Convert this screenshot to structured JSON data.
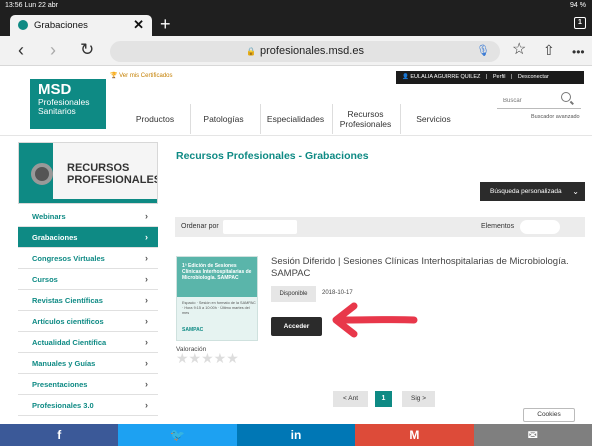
{
  "status_bar": {
    "time": "13:56 Lun 22 abr",
    "system": "94 %"
  },
  "browser": {
    "tab_title": "Grabaciones",
    "tab_close": "✕",
    "new_tab": "+",
    "tab_count": "1",
    "url": "profesionales.msd.es",
    "back_icon": "‹",
    "forward_icon": "›",
    "reload_icon": "↻",
    "star_icon": "☆",
    "share_icon": "⇧",
    "more_icon": "•••"
  },
  "header": {
    "logo_brand": "MSD",
    "logo_line1": "Profesionales",
    "logo_line2": "Sanitarios",
    "certificates_link": "Ver mis Certificados",
    "user_name": "EULALIA AGUIRRE QUILEZ",
    "profile_link": "Perfil",
    "logout_link": "Desconectar",
    "search_placeholder": "Buscar",
    "advanced_search": "Buscador avanzado",
    "nav": [
      {
        "label": "Productos"
      },
      {
        "label": "Patologías"
      },
      {
        "label": "Especialidades"
      },
      {
        "label": "Recursos Profesionales"
      },
      {
        "label": "Servicios"
      }
    ]
  },
  "sidebar": {
    "banner_title_1": "RECURSOS",
    "banner_title_2": "PROFESIONALES",
    "items": [
      {
        "label": "Webinars"
      },
      {
        "label": "Grabaciones"
      },
      {
        "label": "Congresos Virtuales"
      },
      {
        "label": "Cursos"
      },
      {
        "label": "Revistas Científicas"
      },
      {
        "label": "Artículos científicos"
      },
      {
        "label": "Actualidad Científica"
      },
      {
        "label": "Manuales y Guías"
      },
      {
        "label": "Presentaciones"
      },
      {
        "label": "Profesionales 3.0"
      }
    ],
    "chevron": "›"
  },
  "main": {
    "title": "Recursos Profesionales - Grabaciones",
    "custom_search": "Búsqueda personalizada",
    "custom_search_chevron": "⌄",
    "order_label": "Ordenar por",
    "elements_label": "Elementos",
    "recording": {
      "title": "Sesión Diferido | Sesiones Clínicas Interhospitalarias de Microbiología. SAMPAC",
      "status": "Disponible",
      "date": "2018-10-17",
      "access_button": "Acceder",
      "thumb_title": "1ª Edición de Sesiones Clínicas Interhospitalarias de Microbiología. SAMPAC",
      "thumb_text": "Espacio · Sesión en formato de la SAMPAC · Hora 9:15 a 10:00h · Último martes del mes",
      "thumb_logo": "SAMPAC",
      "rating_label": "Valoración",
      "stars": "★★★★★",
      "rating": 0
    },
    "pagination": {
      "prev": "< Ant",
      "current": "1",
      "next": "Sig >"
    },
    "cookies": "Cookies"
  },
  "share_bar": [
    {
      "label": "f",
      "color": "#3b5998"
    },
    {
      "label": "🐦",
      "color": "#1da1f2"
    },
    {
      "label": "in",
      "color": "#0077b5"
    },
    {
      "label": "M",
      "color": "#dd4b39"
    },
    {
      "label": "✉",
      "color": "#7f7f7f"
    }
  ],
  "colors": {
    "accent": "#0e8a84",
    "dark": "#2b2b2b",
    "annotation": "#e8374a"
  }
}
